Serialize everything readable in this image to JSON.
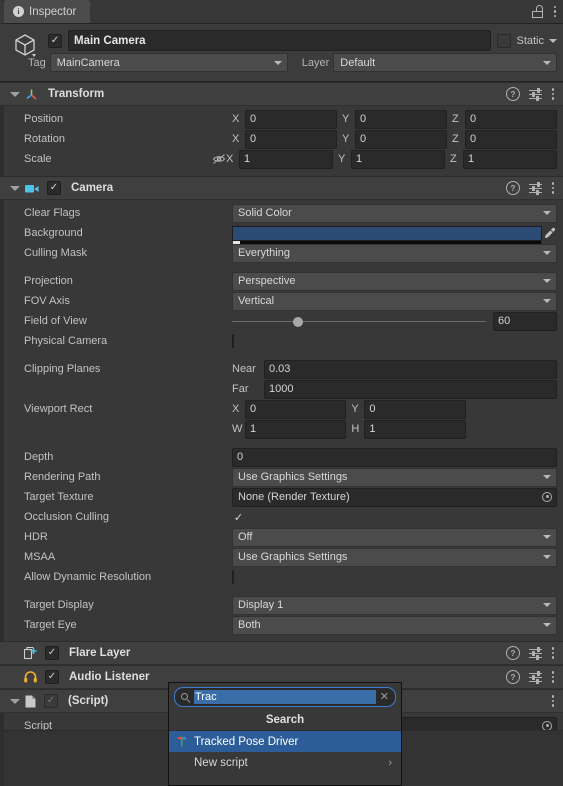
{
  "window": {
    "tab_label": "Inspector",
    "tab_icon": "info-icon",
    "lock_icon": "unlocked-padlock-icon",
    "menu_icon": "kebab-menu-icon"
  },
  "object_header": {
    "prefab_icon": "cube-icon",
    "enabled": true,
    "name": "Main Camera",
    "static_label": "Static",
    "static_checked": false,
    "tag_label": "Tag",
    "tag_value": "MainCamera",
    "layer_label": "Layer",
    "layer_value": "Default"
  },
  "components": [
    {
      "name": "Transform",
      "icon": "transform-axis-icon",
      "has_checkbox": false,
      "expanded": true,
      "rows": [
        {
          "label": "Position",
          "type": "vector3",
          "values": [
            "0",
            "0",
            "0"
          ]
        },
        {
          "label": "Rotation",
          "type": "vector3",
          "values": [
            "0",
            "0",
            "0"
          ]
        },
        {
          "label": "Scale",
          "type": "vector3-locked",
          "values": [
            "1",
            "1",
            "1"
          ],
          "lock_icon": "constrain-proportions-off-icon"
        }
      ]
    },
    {
      "name": "Camera",
      "icon": "camera-icon",
      "has_checkbox": true,
      "enabled": true,
      "expanded": true,
      "rows": [
        {
          "label": "Clear Flags",
          "type": "dropdown",
          "value": "Solid Color"
        },
        {
          "label": "Background",
          "type": "color",
          "value": "#2B4A74",
          "picker_icon": "eyedropper-icon"
        },
        {
          "label": "Culling Mask",
          "type": "dropdown",
          "value": "Everything"
        },
        {
          "label": "",
          "type": "spacer"
        },
        {
          "label": "Projection",
          "type": "dropdown",
          "value": "Perspective"
        },
        {
          "label": "FOV Axis",
          "type": "dropdown",
          "value": "Vertical"
        },
        {
          "label": "Field of View",
          "type": "slider",
          "value": "60",
          "percent": 24
        },
        {
          "label": "Physical Camera",
          "type": "checkbox",
          "checked": false
        },
        {
          "label": "",
          "type": "spacer"
        },
        {
          "label": "Clipping Planes",
          "type": "labeled-number",
          "sub_label": "Near",
          "value": "0.03"
        },
        {
          "label": "",
          "type": "labeled-number",
          "sub_label": "Far",
          "value": "1000"
        },
        {
          "label": "Viewport Rect",
          "type": "vector2",
          "axes": [
            "X",
            "Y"
          ],
          "values": [
            "0",
            "0"
          ]
        },
        {
          "label": "",
          "type": "vector2",
          "axes": [
            "W",
            "H"
          ],
          "values": [
            "1",
            "1"
          ]
        },
        {
          "label": "",
          "type": "spacer"
        },
        {
          "label": "Depth",
          "type": "number",
          "value": "0"
        },
        {
          "label": "Rendering Path",
          "type": "dropdown",
          "value": "Use Graphics Settings"
        },
        {
          "label": "Target Texture",
          "type": "object",
          "value": "None (Render Texture)"
        },
        {
          "label": "Occlusion Culling",
          "type": "checkbox",
          "checked": true
        },
        {
          "label": "HDR",
          "type": "dropdown",
          "value": "Off"
        },
        {
          "label": "MSAA",
          "type": "dropdown",
          "value": "Use Graphics Settings"
        },
        {
          "label": "Allow Dynamic Resolution",
          "type": "checkbox",
          "checked": false
        },
        {
          "label": "",
          "type": "spacer"
        },
        {
          "label": "Target Display",
          "type": "dropdown",
          "value": "Display 1"
        },
        {
          "label": "Target Eye",
          "type": "dropdown",
          "value": "Both"
        }
      ]
    },
    {
      "name": "Flare Layer",
      "icon": "flare-layer-icon",
      "has_checkbox": true,
      "enabled": true,
      "expanded": false,
      "rows": []
    },
    {
      "name": "Audio Listener",
      "icon": "headphones-icon",
      "has_checkbox": true,
      "enabled": true,
      "expanded": false,
      "rows": []
    },
    {
      "name": "(Script)",
      "icon": "script-file-icon",
      "has_checkbox": true,
      "enabled": true,
      "checkbox_dim": true,
      "expanded": true,
      "rows": [
        {
          "label": "Script",
          "type": "object",
          "value": ""
        }
      ]
    }
  ],
  "search_popup": {
    "search_icon": "magnifier-icon",
    "query": "Trac",
    "clear_icon": "clear-x-icon",
    "title": "Search",
    "items": [
      {
        "label": "Tracked Pose Driver",
        "icon": "script-asset-icon",
        "selected": true,
        "submenu": false
      },
      {
        "label": "New script",
        "icon": "",
        "selected": false,
        "submenu": true,
        "arrow": "›"
      }
    ]
  },
  "labels": {
    "axis_x": "X",
    "axis_y": "Y",
    "axis_z": "Z",
    "help": "?",
    "kebab": "⋮"
  }
}
